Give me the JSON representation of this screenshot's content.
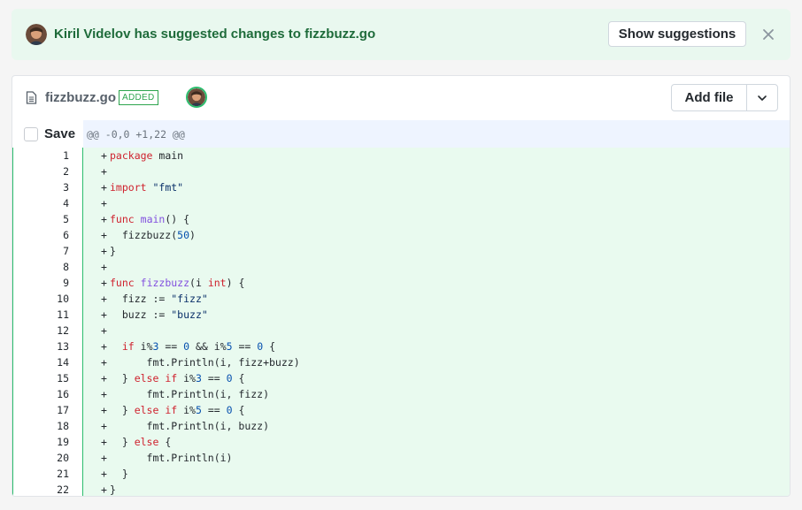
{
  "banner": {
    "message": "Kiril Videlov has suggested changes to fizzbuzz.go",
    "show_button": "Show suggestions",
    "close_icon": "close-icon",
    "avatar_icon": "user-avatar"
  },
  "file": {
    "icon": "file-document-icon",
    "name": "fizzbuzz.go",
    "status_badge": "ADDED",
    "add_file_button": "Add file",
    "dropdown_icon": "chevron-down-icon"
  },
  "hunk": {
    "save_label": "Save",
    "header": "@@ -0,0 +1,22 @@"
  },
  "colors": {
    "banner_bg": "#e9f8ef",
    "banner_text": "#1e6b3a",
    "added_bg": "#e9faef",
    "added_border": "#2dbd6e",
    "hunk_bg": "#eef4ff",
    "keyword": "#cf222e",
    "function": "#8250df",
    "string": "#0a3069",
    "number": "#0550ae"
  },
  "lines": [
    {
      "num": "1",
      "marker": "+",
      "tokens": [
        {
          "t": "package",
          "c": "kw"
        },
        {
          "t": " main",
          "c": ""
        }
      ]
    },
    {
      "num": "2",
      "marker": "+",
      "tokens": []
    },
    {
      "num": "3",
      "marker": "+",
      "tokens": [
        {
          "t": "import",
          "c": "kw"
        },
        {
          "t": " ",
          "c": ""
        },
        {
          "t": "\"fmt\"",
          "c": "str"
        }
      ]
    },
    {
      "num": "4",
      "marker": "+",
      "tokens": []
    },
    {
      "num": "5",
      "marker": "+",
      "tokens": [
        {
          "t": "func",
          "c": "kw"
        },
        {
          "t": " ",
          "c": ""
        },
        {
          "t": "main",
          "c": "fn"
        },
        {
          "t": "() {",
          "c": ""
        }
      ]
    },
    {
      "num": "6",
      "marker": "+",
      "tokens": [
        {
          "t": "  fizzbuzz(",
          "c": ""
        },
        {
          "t": "50",
          "c": "num"
        },
        {
          "t": ")",
          "c": ""
        }
      ]
    },
    {
      "num": "7",
      "marker": "+",
      "tokens": [
        {
          "t": "}",
          "c": ""
        }
      ]
    },
    {
      "num": "8",
      "marker": "+",
      "tokens": []
    },
    {
      "num": "9",
      "marker": "+",
      "tokens": [
        {
          "t": "func",
          "c": "kw"
        },
        {
          "t": " ",
          "c": ""
        },
        {
          "t": "fizzbuzz",
          "c": "fn"
        },
        {
          "t": "(i ",
          "c": ""
        },
        {
          "t": "int",
          "c": "kw"
        },
        {
          "t": ") {",
          "c": ""
        }
      ]
    },
    {
      "num": "10",
      "marker": "+",
      "tokens": [
        {
          "t": "  fizz := ",
          "c": ""
        },
        {
          "t": "\"fizz\"",
          "c": "str"
        }
      ]
    },
    {
      "num": "11",
      "marker": "+",
      "tokens": [
        {
          "t": "  buzz := ",
          "c": ""
        },
        {
          "t": "\"buzz\"",
          "c": "str"
        }
      ]
    },
    {
      "num": "12",
      "marker": "+",
      "tokens": []
    },
    {
      "num": "13",
      "marker": "+",
      "tokens": [
        {
          "t": "  ",
          "c": ""
        },
        {
          "t": "if",
          "c": "kw"
        },
        {
          "t": " i%",
          "c": ""
        },
        {
          "t": "3",
          "c": "num"
        },
        {
          "t": " == ",
          "c": ""
        },
        {
          "t": "0",
          "c": "num"
        },
        {
          "t": " && i%",
          "c": ""
        },
        {
          "t": "5",
          "c": "num"
        },
        {
          "t": " == ",
          "c": ""
        },
        {
          "t": "0",
          "c": "num"
        },
        {
          "t": " {",
          "c": ""
        }
      ]
    },
    {
      "num": "14",
      "marker": "+",
      "tokens": [
        {
          "t": "      fmt.Println(i, fizz+buzz)",
          "c": ""
        }
      ]
    },
    {
      "num": "15",
      "marker": "+",
      "tokens": [
        {
          "t": "  } ",
          "c": ""
        },
        {
          "t": "else",
          "c": "kw"
        },
        {
          "t": " ",
          "c": ""
        },
        {
          "t": "if",
          "c": "kw"
        },
        {
          "t": " i%",
          "c": ""
        },
        {
          "t": "3",
          "c": "num"
        },
        {
          "t": " == ",
          "c": ""
        },
        {
          "t": "0",
          "c": "num"
        },
        {
          "t": " {",
          "c": ""
        }
      ]
    },
    {
      "num": "16",
      "marker": "+",
      "tokens": [
        {
          "t": "      fmt.Println(i, fizz)",
          "c": ""
        }
      ]
    },
    {
      "num": "17",
      "marker": "+",
      "tokens": [
        {
          "t": "  } ",
          "c": ""
        },
        {
          "t": "else",
          "c": "kw"
        },
        {
          "t": " ",
          "c": ""
        },
        {
          "t": "if",
          "c": "kw"
        },
        {
          "t": " i%",
          "c": ""
        },
        {
          "t": "5",
          "c": "num"
        },
        {
          "t": " == ",
          "c": ""
        },
        {
          "t": "0",
          "c": "num"
        },
        {
          "t": " {",
          "c": ""
        }
      ]
    },
    {
      "num": "18",
      "marker": "+",
      "tokens": [
        {
          "t": "      fmt.Println(i, buzz)",
          "c": ""
        }
      ]
    },
    {
      "num": "19",
      "marker": "+",
      "tokens": [
        {
          "t": "  } ",
          "c": ""
        },
        {
          "t": "else",
          "c": "kw"
        },
        {
          "t": " {",
          "c": ""
        }
      ]
    },
    {
      "num": "20",
      "marker": "+",
      "tokens": [
        {
          "t": "      fmt.Println(i)",
          "c": ""
        }
      ]
    },
    {
      "num": "21",
      "marker": "+",
      "tokens": [
        {
          "t": "  }",
          "c": ""
        }
      ]
    },
    {
      "num": "22",
      "marker": "+",
      "tokens": [
        {
          "t": "}",
          "c": ""
        }
      ]
    }
  ]
}
